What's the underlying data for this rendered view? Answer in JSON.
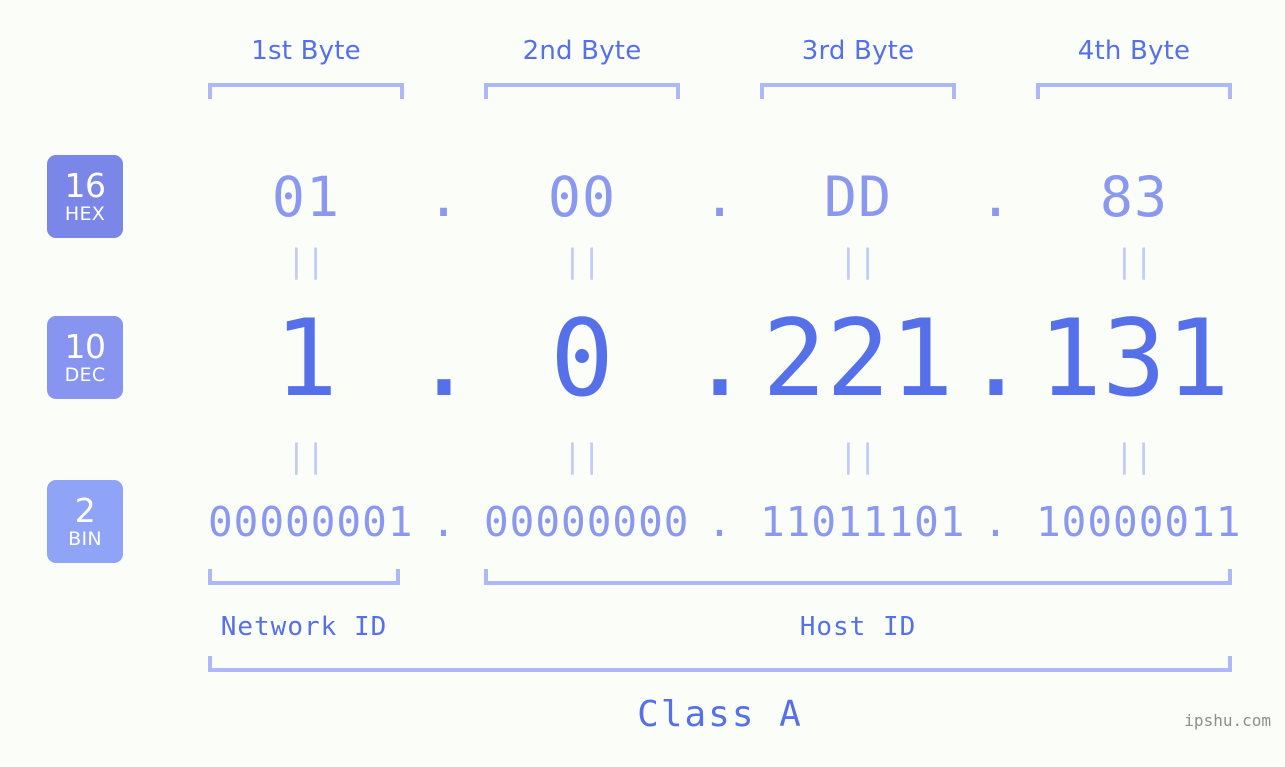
{
  "background_color": "#fbfdf8",
  "accent_strong": "#5570e8",
  "accent_mid": "#8a98ef",
  "accent_light": "#aeb8f9",
  "headers": [
    {
      "label": "1st Byte"
    },
    {
      "label": "2nd Byte"
    },
    {
      "label": "3rd Byte"
    },
    {
      "label": "4th Byte"
    }
  ],
  "rows": {
    "hex": {
      "badge_number": "16",
      "badge_base": "HEX",
      "badge_color": "#7b87e8",
      "values": [
        "01",
        "00",
        "DD",
        "83"
      ],
      "separator": "."
    },
    "dec": {
      "badge_number": "10",
      "badge_base": "DEC",
      "badge_color": "#8794f0",
      "values": [
        "1",
        "0",
        "221",
        "131"
      ],
      "separator": "."
    },
    "bin": {
      "badge_number": "2",
      "badge_base": "BIN",
      "badge_color": "#8fa3f7",
      "values": [
        "00000001",
        "00000000",
        "11011101",
        "10000011"
      ],
      "separator": "."
    }
  },
  "equality_marks": {
    "glyph": "||",
    "count_per_gap": 4
  },
  "segments": {
    "network_id": "Network ID",
    "host_id": "Host ID"
  },
  "class_label": "Class A",
  "watermark": "ipshu.com"
}
